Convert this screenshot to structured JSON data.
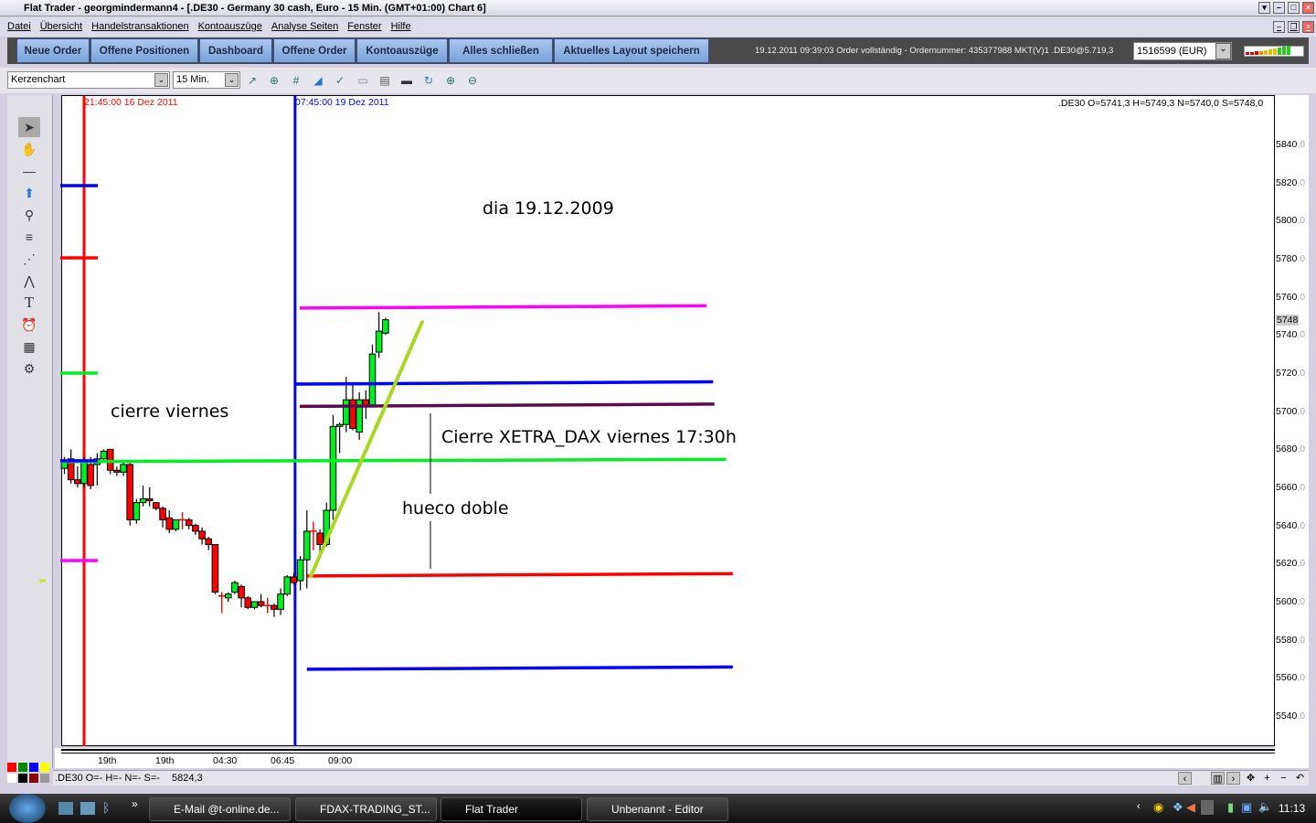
{
  "window": {
    "title": "Flat Trader - georgmindermann4  - [.DE30 - Germany 30 cash, Euro - 15 Min. (GMT+01:00)   Chart 6]"
  },
  "menu": [
    "Datei",
    "Übersicht",
    "Handelstransaktionen",
    "Kontoauszüge",
    "Analyse Seiten",
    "Fenster",
    "Hilfe"
  ],
  "nav": {
    "buttons": [
      "Neue Order",
      "Offene Positionen",
      "Dashboard",
      "Offene Order",
      "Kontoauszüge",
      "Alles schließen",
      "Aktuelles Layout speichern"
    ],
    "status_message": "19.12.2011 09:39:03 Order vollständig - Ordernummer: 435377988 MKT(V)1 .DE30@5.719,3",
    "account": "1516599 (EUR)"
  },
  "toolbar": {
    "chart_type": "Kerzenchart",
    "interval": "15 Min."
  },
  "chart_data": {
    "type": "candlestick",
    "ohlc_label": ".DE30 O=5741,3 H=5749,3 N=5740,0 S=5748,0",
    "current_price_label": "5748",
    "ylim": [
      5530,
      5860
    ],
    "y_ticks": [
      "5840",
      "5820",
      "5800",
      "5780",
      "5760",
      "5740",
      "5720",
      "5700",
      "5680",
      "5660",
      "5640",
      "5620",
      "5600",
      "5580",
      "5560",
      "5540"
    ],
    "y_tick_decimal": ",0",
    "x_ticks": [
      "19th",
      "19th",
      "04:30",
      "06:45",
      "09:00"
    ],
    "vline_labels": [
      {
        "text": "21:45:00 16 Dez 2011",
        "color": "#ff0000"
      },
      {
        "text": "07:45:00 19 Dez 2011",
        "color": "#0000ff"
      }
    ],
    "candles": [
      [
        5670,
        5676,
        5667,
        5674
      ],
      [
        5675,
        5680,
        5662,
        5664
      ],
      [
        5664,
        5671,
        5660,
        5662
      ],
      [
        5662,
        5676,
        5660,
        5674
      ],
      [
        5672,
        5676,
        5659,
        5661
      ],
      [
        5672,
        5678,
        5661,
        5675
      ],
      [
        5675,
        5680,
        5674,
        5679
      ],
      [
        5680,
        5680,
        5667,
        5669
      ],
      [
        5669,
        5671,
        5666,
        5668
      ],
      [
        5668,
        5673,
        5666,
        5672
      ],
      [
        5672,
        5673,
        5640,
        5643
      ],
      [
        5643,
        5654,
        5641,
        5652
      ],
      [
        5652,
        5661,
        5650,
        5654
      ],
      [
        5654,
        5660,
        5650,
        5653
      ],
      [
        5652,
        5652,
        5648,
        5649
      ],
      [
        5649,
        5650,
        5639,
        5643
      ],
      [
        5644,
        5648,
        5636,
        5638
      ],
      [
        5638,
        5643,
        5637,
        5643
      ],
      [
        5643,
        5647,
        5638,
        5643
      ],
      [
        5643,
        5644,
        5638,
        5640
      ],
      [
        5640,
        5641,
        5635,
        5637
      ],
      [
        5637,
        5639,
        5630,
        5633
      ],
      [
        5633,
        5634,
        5627,
        5630
      ],
      [
        5630,
        5630,
        5604,
        5605
      ],
      [
        5603,
        5605,
        5594,
        5603
      ],
      [
        5602,
        5605,
        5600,
        5604
      ],
      [
        5605,
        5611,
        5604,
        5610
      ],
      [
        5608,
        5609,
        5597,
        5602
      ],
      [
        5602,
        5603,
        5596,
        5597
      ],
      [
        5597,
        5600,
        5596,
        5600
      ],
      [
        5600,
        5604,
        5597,
        5598
      ],
      [
        5598,
        5602,
        5594,
        5598
      ],
      [
        5598,
        5599,
        5592,
        5596
      ],
      [
        5596,
        5607,
        5593,
        5604
      ],
      [
        5604,
        5614,
        5603,
        5613
      ],
      [
        5613,
        5615,
        5609,
        5610
      ],
      [
        5611,
        5624,
        5606,
        5622
      ],
      [
        5622,
        5648,
        5607,
        5637
      ],
      [
        5637,
        5642,
        5627,
        5637
      ],
      [
        5636,
        5638,
        5625,
        5630
      ],
      [
        5630,
        5652,
        5629,
        5648
      ],
      [
        5648,
        5698,
        5643,
        5692
      ],
      [
        5692,
        5694,
        5678,
        5693
      ],
      [
        5693,
        5718,
        5689,
        5706
      ],
      [
        5706,
        5715,
        5690,
        5691
      ],
      [
        5689,
        5710,
        5685,
        5706
      ],
      [
        5706,
        5711,
        5696,
        5703
      ],
      [
        5703,
        5735,
        5702,
        5730
      ],
      [
        5731,
        5752,
        5728,
        5742
      ],
      [
        5741,
        5749,
        5740,
        5748
      ]
    ],
    "colors": {
      "up": "#00ee22",
      "down": "#ff0000"
    },
    "drawings": [
      {
        "type": "hline",
        "price": 5754.6,
        "from_bar": 35.9,
        "to_bar": 98,
        "color": "#ff00ff"
      },
      {
        "type": "hline",
        "price": 5714.7,
        "from_bar": 35.1,
        "to_bar": 99,
        "color": "#0000ff"
      },
      {
        "type": "hline",
        "price": 5703,
        "from_bar": 35.9,
        "to_bar": 99.2,
        "color": "#5a0a50"
      },
      {
        "type": "hline",
        "price": 5674,
        "from_bar": -0.5,
        "to_bar": 101,
        "color": "#00ee22"
      },
      {
        "type": "hline",
        "price": 5614,
        "from_bar": 37,
        "to_bar": 102,
        "color": "#ff0000"
      },
      {
        "type": "hline",
        "price": 5565,
        "from_bar": 37,
        "to_bar": 102,
        "color": "#0000ff"
      },
      {
        "type": "trend",
        "p1": [
          37.6,
          5613.4
        ],
        "p2": [
          54.6,
          5746.9
        ],
        "color": "#a8d820"
      },
      {
        "type": "vline",
        "bar": 3,
        "color": "#ff0000"
      },
      {
        "type": "vline",
        "bar": 35.2,
        "color": "#0000ff"
      },
      {
        "type": "marker",
        "price": 5818.4,
        "color": "#0000ff"
      },
      {
        "type": "marker",
        "price": 5780.5,
        "color": "#ff0000"
      },
      {
        "type": "marker",
        "price": 5720,
        "color": "#00ee22"
      },
      {
        "type": "marker",
        "price": 5674,
        "color": "#0000ff"
      },
      {
        "type": "marker",
        "price": 5621.6,
        "color": "#ff00ff"
      }
    ],
    "annotations": [
      "dia 19.12.2009",
      "cierre viernes",
      "Cierre XETRA_DAX viernes 17:30h",
      "hueco doble"
    ]
  },
  "statusbar": {
    "ohlc": ".DE30 O=- H=- N=- S=-",
    "price": "5824,3"
  },
  "taskbar": {
    "items": [
      "E-Mail @t-online.de...",
      "FDAX-TRADING_ST...",
      "Flat Trader",
      "Unbenannt - Editor"
    ],
    "clock": "11:13"
  }
}
